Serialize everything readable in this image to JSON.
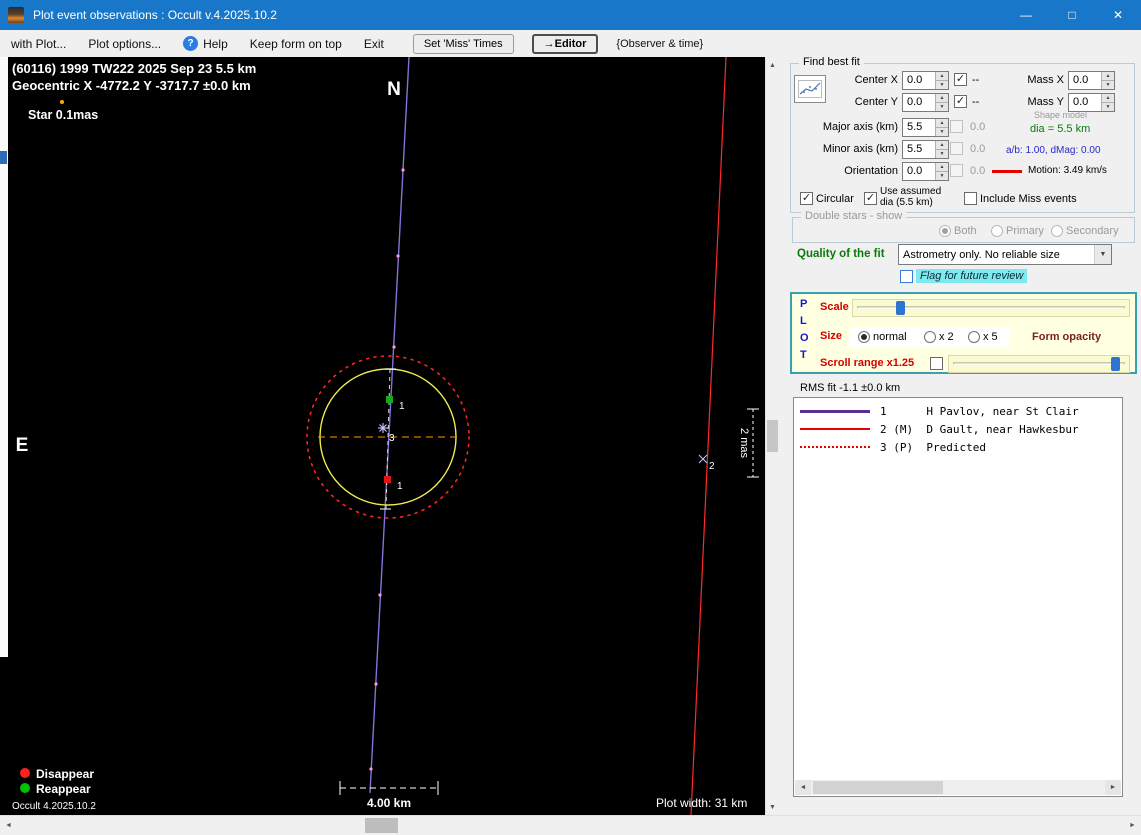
{
  "window": {
    "title": "Plot event observations : Occult v.4.2025.10.2",
    "minimize_icon": "—",
    "maximize_icon": "□",
    "close_icon": "✕"
  },
  "menubar": {
    "with_plot": "with Plot...",
    "plot_options": "Plot options...",
    "help": "Help",
    "keep_on_top": "Keep form on top",
    "exit": "Exit",
    "set_miss_times": "Set 'Miss' Times",
    "editor": "→Editor",
    "observer_time": "{Observer & time}"
  },
  "plot": {
    "header1": "(60116) 1999 TW222  2025 Sep 23  5.5 km",
    "header2": "Geocentric X  -4772.2  Y -3717.7 ±0.0 km",
    "star_label": "Star 0.1mas",
    "north": "N",
    "east": "E",
    "marker_reappear": "1",
    "marker_disappear": "1",
    "marker_star": "3",
    "chord2_marker": "2",
    "mas_label": "2 mas",
    "scale_label": "4.00 km",
    "width_label": "Plot width: 31 km",
    "legend_disappear": "Disappear",
    "legend_reappear": "Reappear",
    "version": "Occult 4.2025.10.2"
  },
  "fit": {
    "title": "Find best fit",
    "center_x": {
      "label": "Center X",
      "value": "0.0",
      "dash": "--"
    },
    "center_y": {
      "label": "Center Y",
      "value": "0.0",
      "dash": "--"
    },
    "mass_x": {
      "label": "Mass X",
      "value": "0.0"
    },
    "mass_y": {
      "label": "Mass Y",
      "value": "0.0"
    },
    "major_axis": {
      "label": "Major axis (km)",
      "value": "5.5",
      "alt": "0.0"
    },
    "minor_axis": {
      "label": "Minor axis (km)",
      "value": "5.5",
      "alt": "0.0"
    },
    "orientation": {
      "label": "Orientation",
      "value": "0.0",
      "alt": "0.0"
    },
    "shape_model": "Shape model",
    "dia": "dia = 5.5 km",
    "ab_dmag": "a/b: 1.00, dMag: 0.00",
    "motion": "Motion: 3.49 km/s",
    "circular": "Circular",
    "use_assumed_1": "Use assumed",
    "use_assumed_2": "dia (5.5 km)",
    "include_miss": "Include Miss events"
  },
  "double_stars": {
    "title": "Double stars - show",
    "both": "Both",
    "primary": "Primary",
    "secondary": "Secondary"
  },
  "quality": {
    "label": "Quality of the fit",
    "value": "Astrometry only. No reliable size",
    "flag": "Flag for future review"
  },
  "plot_controls": {
    "p": "P",
    "l": "L",
    "o": "O",
    "t": "T",
    "scale": "Scale",
    "size": "Size",
    "size_normal": "normal",
    "size_x2": "x 2",
    "size_x5": "x 5",
    "form_opacity": "Form opacity",
    "scroll_range": "Scroll range x1.25"
  },
  "rms_fit": "RMS fit -1.1 ±0.0 km",
  "observations": [
    {
      "text": "1      H Pavlov, near St Clair"
    },
    {
      "text": "2 (M)  D Gault, near Hawkesbur"
    },
    {
      "text": "3 (P)  Predicted"
    }
  ],
  "icons": {
    "help": "?",
    "spin_up": "▲",
    "spin_down": "▼",
    "combo": "▼",
    "scroll_up": "▲",
    "scroll_down": "▼",
    "scroll_left": "◄",
    "scroll_right": "►"
  },
  "colors": {
    "titlebar": "#1877c9",
    "chord1": "#8273d8",
    "chord2": "#ff2a2a",
    "asteroid_outline": "#ecec4e",
    "uncertainty": "#ff2222",
    "crosshair": "#ff9900",
    "flag_highlight": "#7fe9f0",
    "accent_blue": "#2f74d0"
  }
}
